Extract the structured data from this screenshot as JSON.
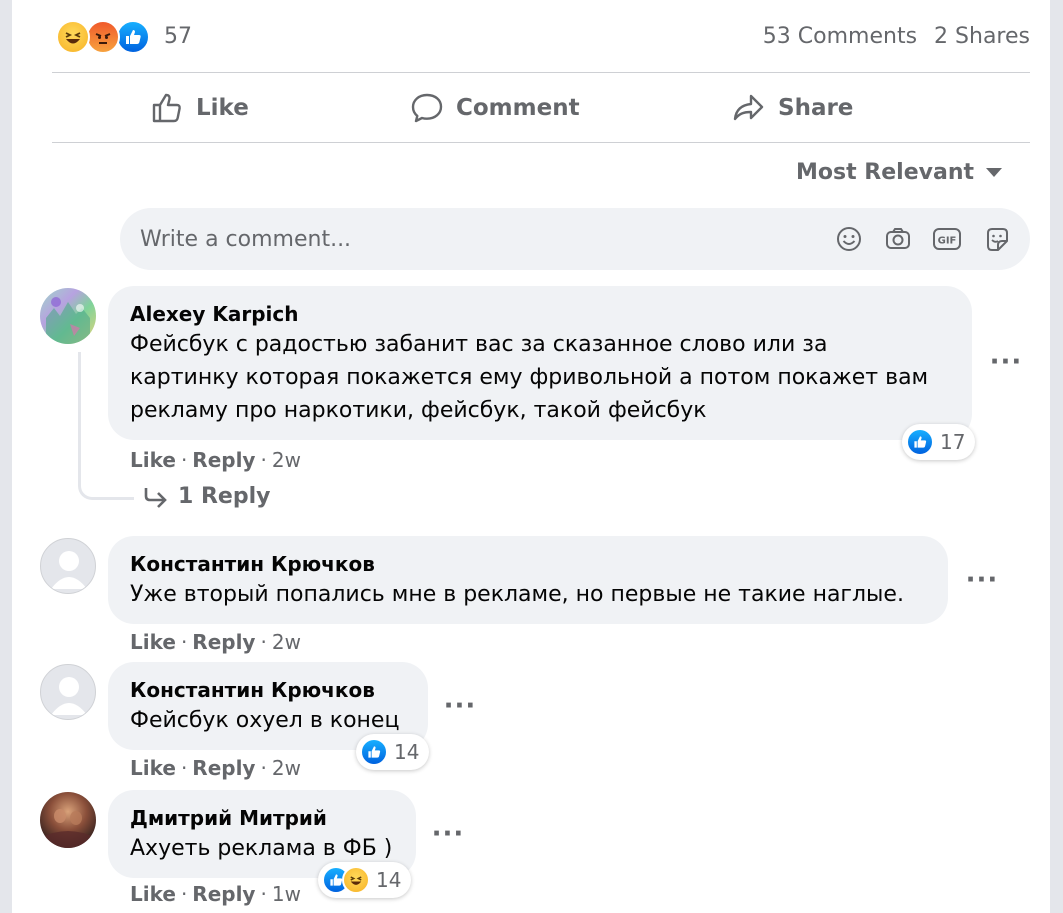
{
  "post": {
    "reaction_count": "57",
    "reaction_icons": [
      "haha-icon",
      "angry-icon",
      "like-icon"
    ],
    "comments_label": "53 Comments",
    "shares_label": "2 Shares"
  },
  "actions": {
    "like": "Like",
    "comment": "Comment",
    "share": "Share"
  },
  "sort": {
    "label": "Most Relevant"
  },
  "composer": {
    "placeholder": "Write a comment..."
  },
  "comments": [
    {
      "author": "Alexey Karpich",
      "text": "Фейсбук с радостью забанит вас за сказанное слово или за\nкартинку которая покажется ему фривольной а потом покажет вам\nрекламу про наркотики, фейсбук, такой фейсбук",
      "like_label": "Like",
      "reply_label": "Reply",
      "time": "2w",
      "reactions": "17",
      "replies_label": "1 Reply"
    },
    {
      "author": "Константин Крючков",
      "text": "Уже вторый попались мне в рекламе, но первые не такие наглые.",
      "like_label": "Like",
      "reply_label": "Reply",
      "time": "2w"
    },
    {
      "author": "Константин Крючков",
      "text": "Фейсбук охуел в конец",
      "like_label": "Like",
      "reply_label": "Reply",
      "time": "2w",
      "reactions": "14"
    },
    {
      "author": "Дмитрий Митрий",
      "text": "Ахуеть реклама в ФБ )",
      "like_label": "Like",
      "reply_label": "Reply",
      "time": "1w",
      "reactions": "14"
    }
  ],
  "colors": {
    "text_secondary": "#65676b",
    "bubble": "#f0f2f5",
    "like_blue": "#1877f2"
  }
}
